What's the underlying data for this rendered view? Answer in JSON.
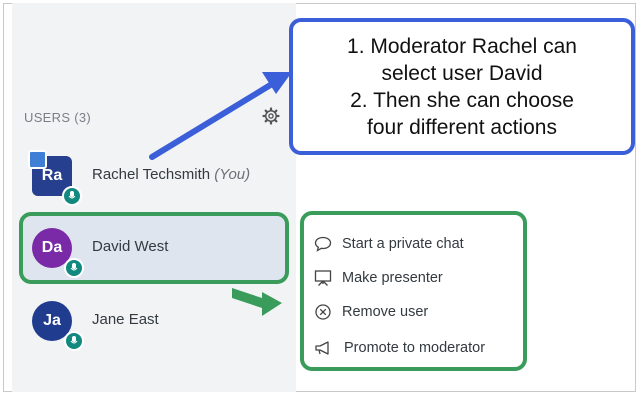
{
  "users_panel": {
    "header": "USERS (3)",
    "users": [
      {
        "initials": "Ra",
        "name": "Rachel Techsmith",
        "suffix": "(You)",
        "avatar_color": "#263f8f",
        "shape": "square",
        "presenter": true
      },
      {
        "initials": "Da",
        "name": "David West",
        "suffix": "",
        "avatar_color": "#7b2aa7",
        "shape": "round",
        "selected": true
      },
      {
        "initials": "Ja",
        "name": "Jane East",
        "suffix": "",
        "avatar_color": "#1f3c8f",
        "shape": "round"
      }
    ]
  },
  "context_menu": {
    "items": [
      {
        "label": "Start a private chat",
        "icon": "chat-bubble-icon"
      },
      {
        "label": "Make presenter",
        "icon": "presentation-board-icon"
      },
      {
        "label": "Remove user",
        "icon": "close-circle-icon"
      },
      {
        "label": "Promote to moderator",
        "icon": "megaphone-icon"
      }
    ]
  },
  "callout": {
    "lines": [
      "1. Moderator Rachel can",
      "select user David",
      "2. Then she can choose",
      "four different actions"
    ]
  },
  "colors": {
    "callout_border": "#3b5fd9",
    "highlight_border": "#3a9c5a",
    "mic_badge": "#12897f"
  }
}
